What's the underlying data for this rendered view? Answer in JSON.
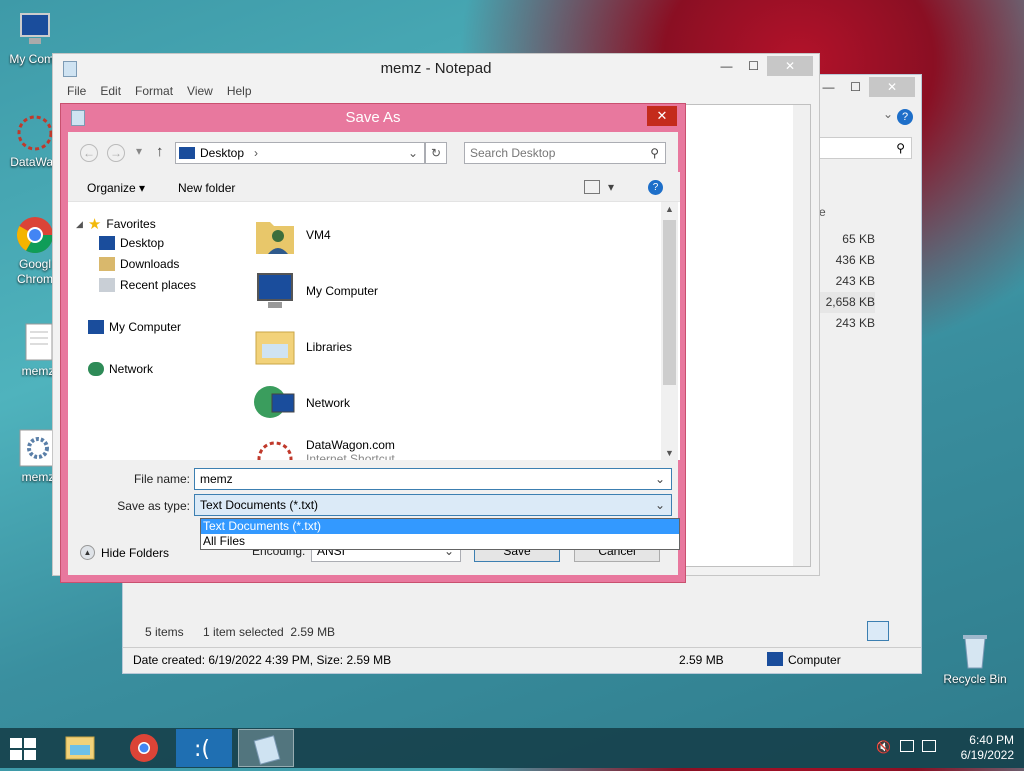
{
  "desktop": {
    "icons": [
      {
        "label": "My Comp",
        "name": "my-computer"
      },
      {
        "label": "DataWag",
        "name": "datawagon"
      },
      {
        "label": "Googl Chrom",
        "name": "google-chrome"
      },
      {
        "label": "memz",
        "name": "memz-text"
      },
      {
        "label": "memz",
        "name": "memz-exe"
      },
      {
        "label": "Recycle Bin",
        "name": "recycle-bin"
      }
    ]
  },
  "explorer": {
    "col_header": "ze",
    "sizes": [
      "65 KB",
      "436 KB",
      "243 KB",
      "2,658 KB",
      "243 KB"
    ],
    "status_items": "5 items",
    "status_selected": "1 item selected  2.59 MB",
    "details": "Date created: 6/19/2022 4:39 PM, Size: 2.59 MB",
    "details_size": "2.59 MB",
    "details_location": "Computer"
  },
  "notepad": {
    "title": "memz - Notepad",
    "menu": [
      "File",
      "Edit",
      "Format",
      "View",
      "Help"
    ]
  },
  "dialog": {
    "title": "Save As",
    "address": "Desktop",
    "search_placeholder": "Search Desktop",
    "organize": "Organize",
    "new_folder": "New folder",
    "tree": {
      "favorites": "Favorites",
      "desktop": "Desktop",
      "downloads": "Downloads",
      "recent": "Recent places",
      "my_computer": "My Computer",
      "network": "Network"
    },
    "items": [
      {
        "label": "VM4"
      },
      {
        "label": "My Computer"
      },
      {
        "label": "Libraries"
      },
      {
        "label": "Network"
      },
      {
        "label": "DataWagon.com",
        "sub": "Internet Shortcut"
      }
    ],
    "file_name_label": "File name:",
    "file_name_value": "memz",
    "save_type_label": "Save as type:",
    "save_type_value": "Text Documents (*.txt)",
    "type_options": [
      "Text Documents (*.txt)",
      "All Files"
    ],
    "hide_folders": "Hide Folders",
    "encoding_label": "Encoding:",
    "encoding_value": "ANSI",
    "save": "Save",
    "cancel": "Cancel"
  },
  "taskbar": {
    "time": "6:40 PM",
    "date": "6/19/2022"
  },
  "colors": {
    "dialog_frame": "#e8789e",
    "selection": "#3399ff",
    "taskbar": "#143c46"
  }
}
